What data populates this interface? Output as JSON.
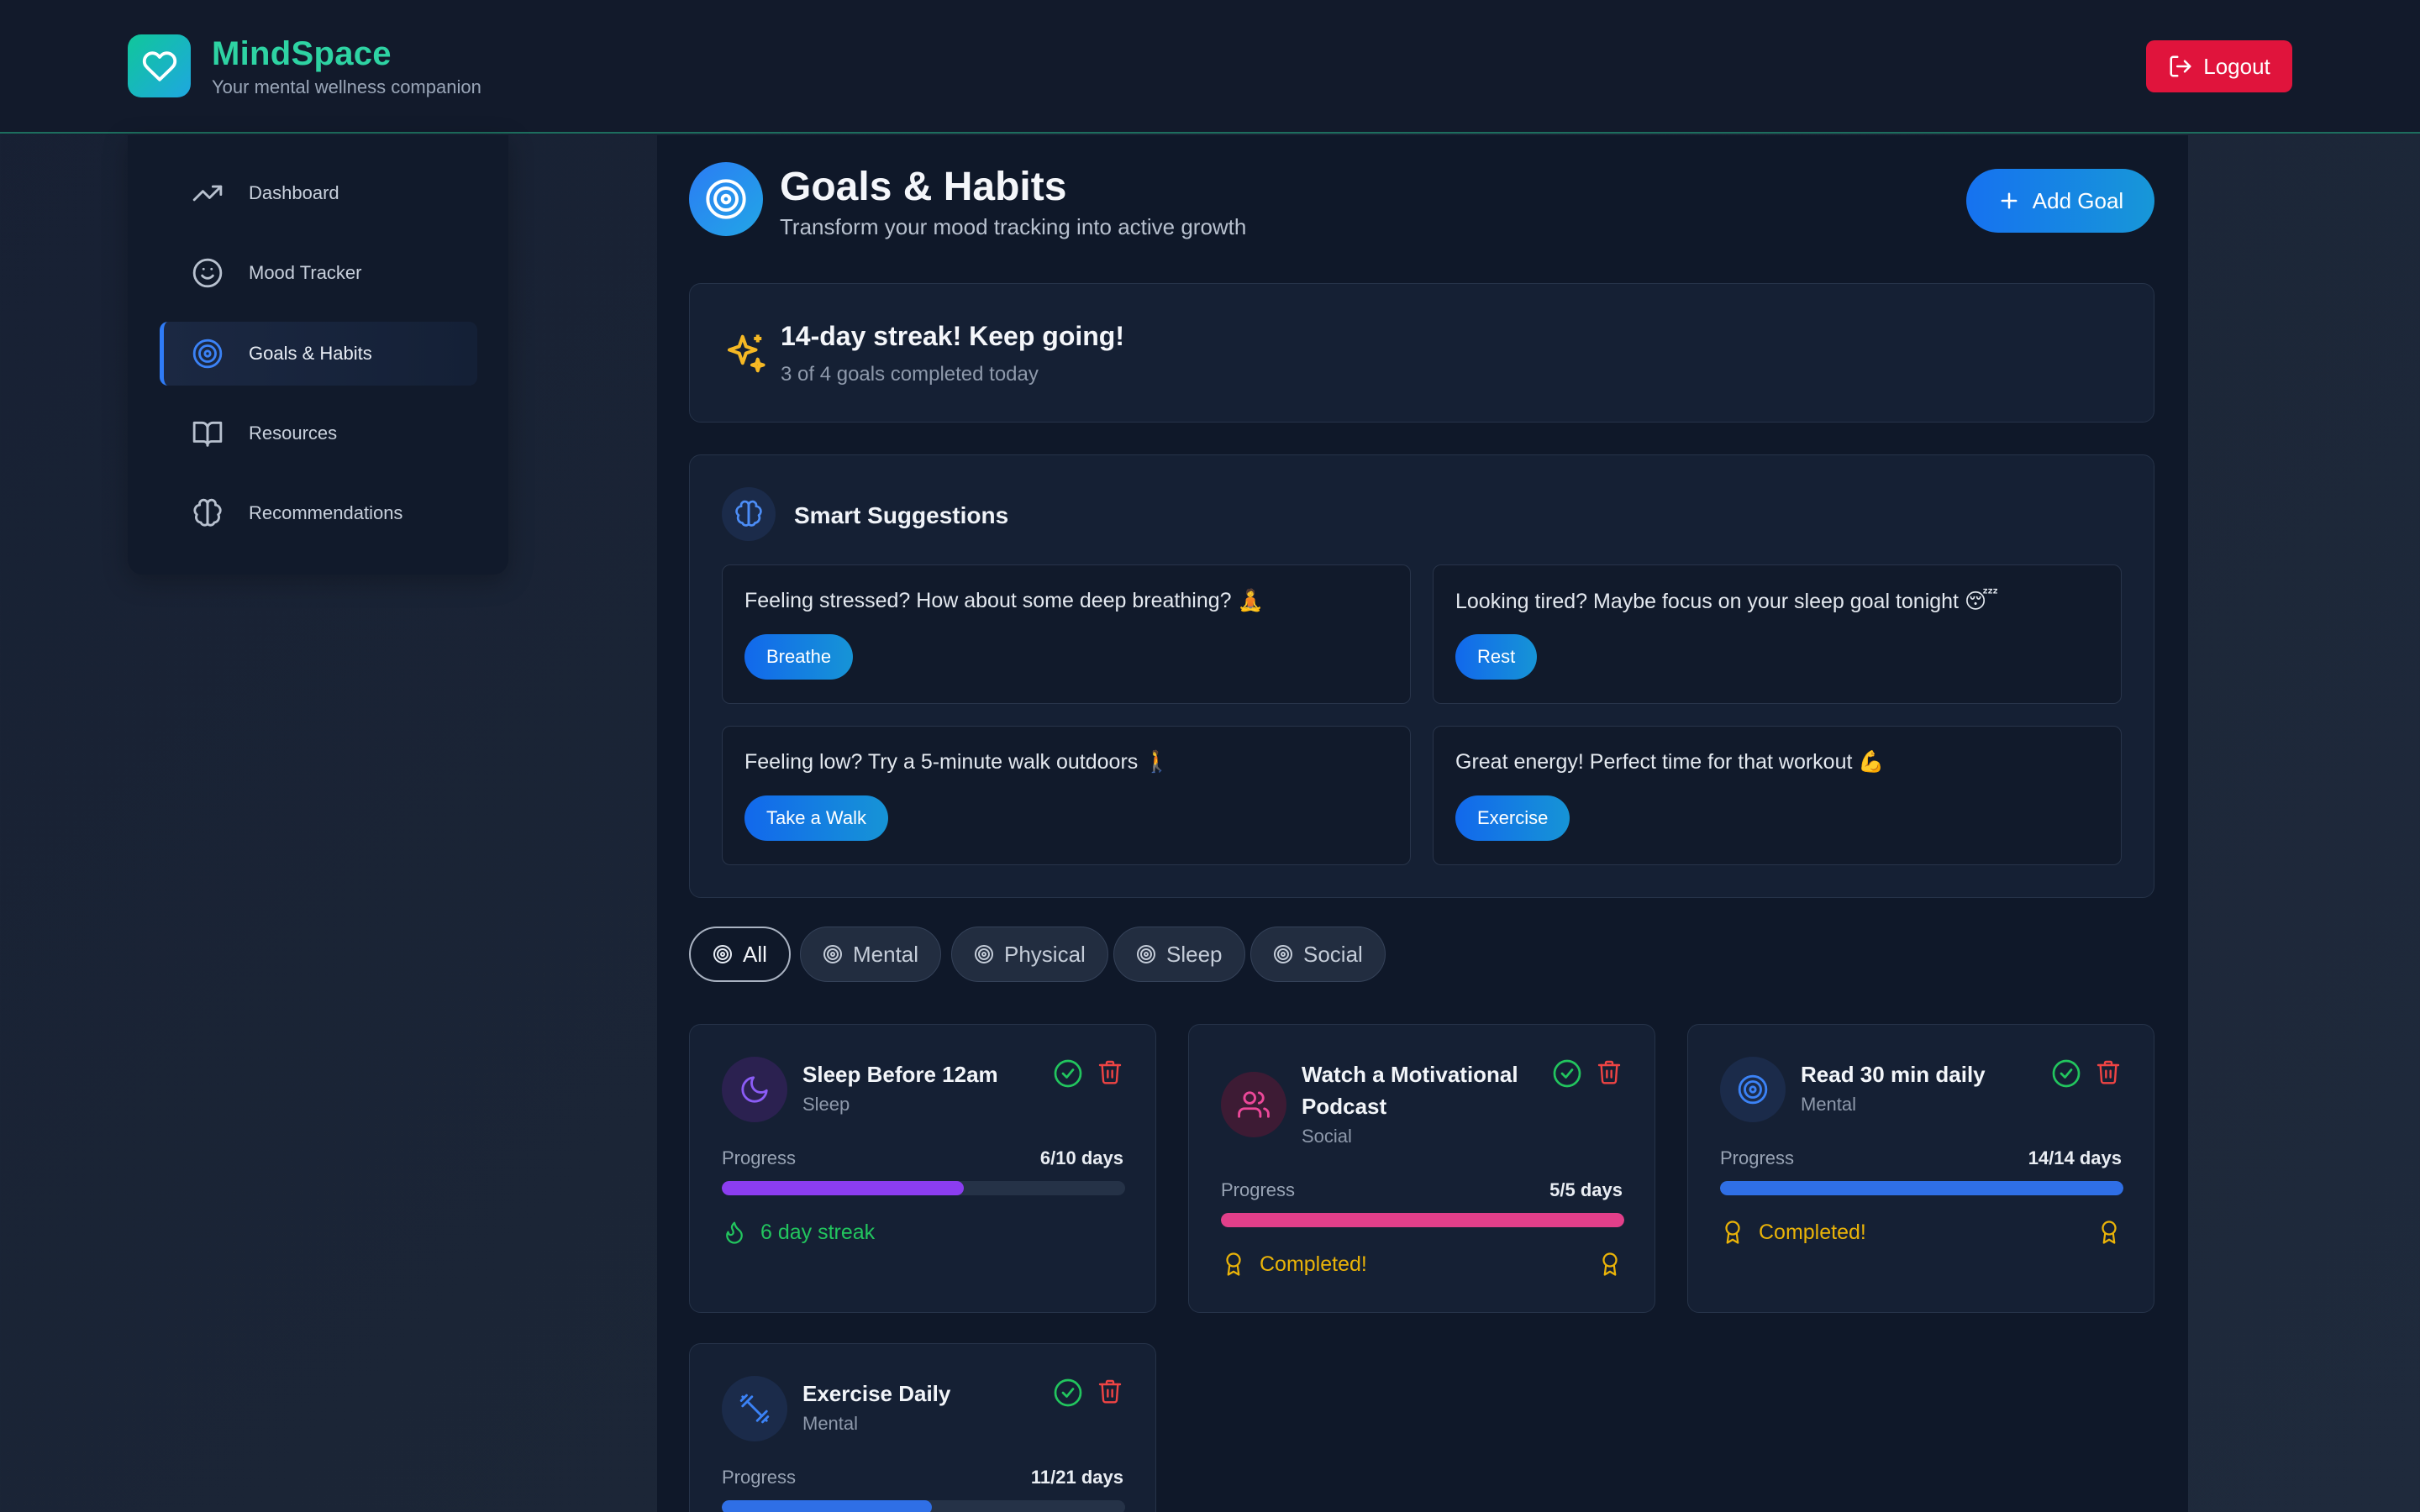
{
  "app": {
    "name": "MindSpace",
    "tagline": "Your mental wellness companion",
    "logout_label": "Logout",
    "accent": "#2ed3a3",
    "icons": {
      "logo": "heart-icon",
      "logout": "logout-icon"
    }
  },
  "sidebar": {
    "items": [
      {
        "label": "Dashboard",
        "icon": "trending-up-icon",
        "active": false
      },
      {
        "label": "Mood Tracker",
        "icon": "smile-icon",
        "active": false
      },
      {
        "label": "Goals & Habits",
        "icon": "target-icon",
        "active": true
      },
      {
        "label": "Resources",
        "icon": "book-icon",
        "active": false
      },
      {
        "label": "Recommendations",
        "icon": "brain-icon",
        "active": false
      }
    ]
  },
  "page": {
    "title": "Goals & Habits",
    "subtitle": "Transform your mood tracking into active growth",
    "add_goal_label": "Add Goal"
  },
  "streak": {
    "title": "14-day streak! Keep going!",
    "subtitle": "3 of 4 goals completed today",
    "icon": "sparkles-icon"
  },
  "suggestions": {
    "title": "Smart Suggestions",
    "items": [
      {
        "text": "Feeling stressed? How about some deep breathing? 🧘",
        "action": "Breathe"
      },
      {
        "text": "Looking tired? Maybe focus on your sleep goal tonight 😴",
        "action": "Rest"
      },
      {
        "text": "Feeling low? Try a 5-minute walk outdoors 🚶",
        "action": "Take a Walk"
      },
      {
        "text": "Great energy! Perfect time for that workout 💪",
        "action": "Exercise"
      }
    ]
  },
  "filters": {
    "options": [
      "All",
      "Mental",
      "Physical",
      "Sleep",
      "Social"
    ],
    "selected": "All"
  },
  "goals": [
    {
      "name": "Sleep Before 12am",
      "category": "Sleep",
      "icon": "moon-icon",
      "progress_label": "Progress",
      "progress_text": "6/10 days",
      "progress": 0.6,
      "color": "#8b3df0",
      "status": "6 day streak",
      "status_icon": "flame-icon",
      "completed": false
    },
    {
      "name": "Watch a Motivational Podcast",
      "category": "Social",
      "icon": "users-icon",
      "progress_label": "Progress",
      "progress_text": "5/5 days",
      "progress": 1.0,
      "color": "#e23f8a",
      "status": "Completed!",
      "status_icon": "award-icon",
      "completed": true
    },
    {
      "name": "Read 30 min daily",
      "category": "Mental",
      "icon": "target-icon",
      "progress_label": "Progress",
      "progress_text": "14/14 days",
      "progress": 1.0,
      "color": "#2f6fe6",
      "status": "Completed!",
      "status_icon": "award-icon",
      "completed": true
    },
    {
      "name": "Exercise Daily",
      "category": "Mental",
      "icon": "dumbbell-icon",
      "progress_label": "Progress",
      "progress_text": "11/21 days",
      "progress": 0.52,
      "color": "#2f6fe6",
      "status": "",
      "status_icon": "",
      "completed": false
    }
  ]
}
